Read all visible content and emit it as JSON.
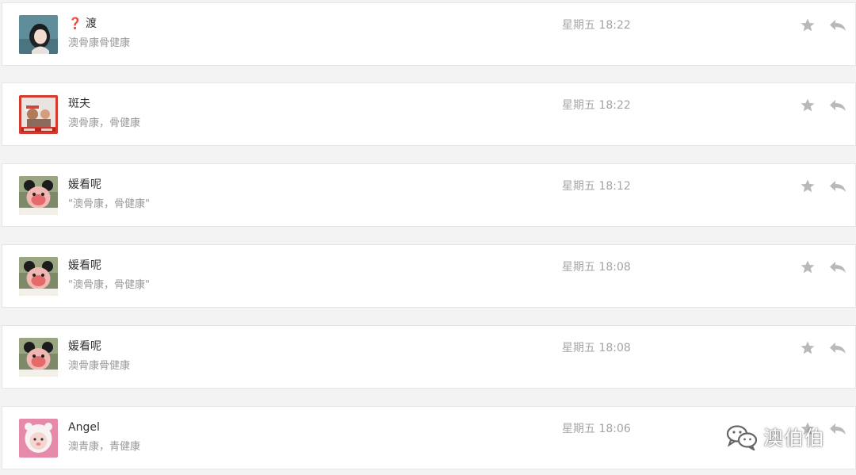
{
  "theme": {
    "icon_color": "#b8b8b8"
  },
  "messages": [
    {
      "sender": "❓ 渡",
      "preview": "澳骨康骨健康",
      "time": "星期五 18:22",
      "avatar_icon": "girl-portrait-avatar"
    },
    {
      "sender": "斑夫",
      "preview": "澳骨康，骨健康",
      "time": "星期五 18:22",
      "avatar_icon": "family-photo-avatar"
    },
    {
      "sender": "媛看呢",
      "preview": "\"澳骨康，骨健康\"",
      "time": "星期五 18:12",
      "avatar_icon": "panda-doll-avatar"
    },
    {
      "sender": "媛看呢",
      "preview": "\"澳骨康，骨健康\"",
      "time": "星期五 18:08",
      "avatar_icon": "panda-doll-avatar"
    },
    {
      "sender": "媛看呢",
      "preview": "澳骨康骨健康",
      "time": "星期五 18:08",
      "avatar_icon": "panda-doll-avatar"
    },
    {
      "sender": "Angel",
      "preview": "澳青康，青健康",
      "time": "星期五 18:06",
      "avatar_icon": "pink-baby-avatar"
    }
  ],
  "watermark": {
    "text": "澳伯伯",
    "icon": "wechat-logo-icon"
  }
}
